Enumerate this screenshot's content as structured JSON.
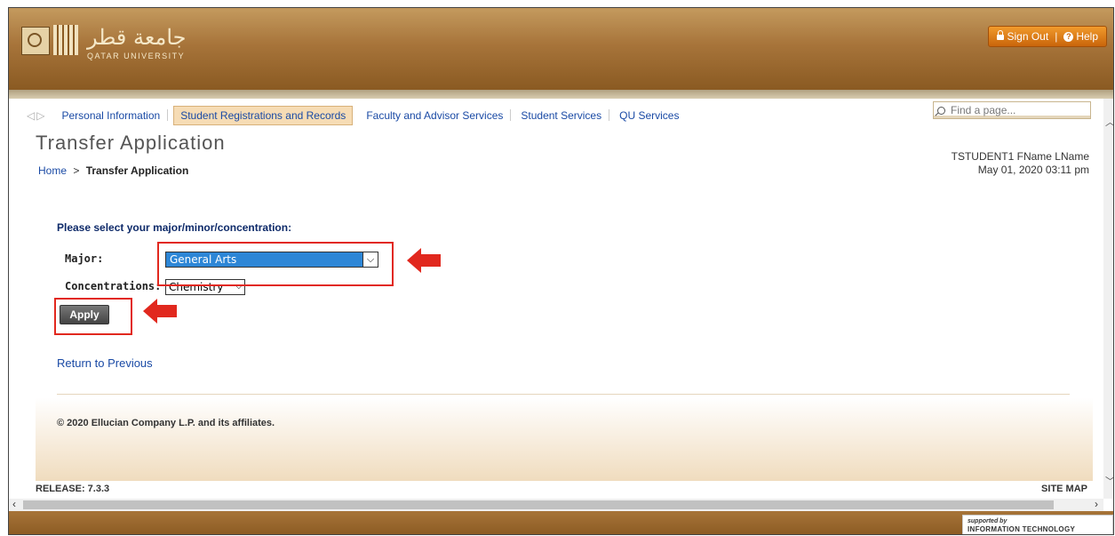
{
  "header": {
    "logo_arabic": "جامعة قطر",
    "logo_english": "QATAR UNIVERSITY",
    "sign_out_label": "Sign Out",
    "separator": "|",
    "help_label": "Help"
  },
  "nav": {
    "tabs": [
      {
        "label": "Personal Information",
        "active": false
      },
      {
        "label": "Student Registrations and Records",
        "active": true
      },
      {
        "label": "Faculty and Advisor Services",
        "active": false
      },
      {
        "label": "Student Services",
        "active": false
      },
      {
        "label": "QU Services",
        "active": false
      }
    ],
    "find_placeholder": "Find a page..."
  },
  "page": {
    "title": "Transfer Application",
    "breadcrumb_home": "Home",
    "breadcrumb_sep": ">",
    "breadcrumb_current": "Transfer Application",
    "user_name": "TSTUDENT1 FName LName",
    "datetime": "May 01, 2020 03:11 pm"
  },
  "form": {
    "heading": "Please select your major/minor/concentration:",
    "major_label": "Major:",
    "major_value": "General Arts",
    "concentrations_label": "Concentrations:",
    "concentration_value": "Chemistry",
    "apply_label": "Apply",
    "return_link": "Return to Previous"
  },
  "footer": {
    "copyright": "© 2020 Ellucian Company L.P. and its affiliates.",
    "release": "RELEASE: 7.3.3",
    "site_map": "SITE MAP",
    "supported_by": "supported by",
    "its": "INFORMATION TECHNOLOGY SERVICES"
  },
  "colors": {
    "header_brown": "#a7743a",
    "link_blue": "#1a4aa5",
    "highlight_red": "#e1281e",
    "select_blue": "#2d86d6"
  }
}
